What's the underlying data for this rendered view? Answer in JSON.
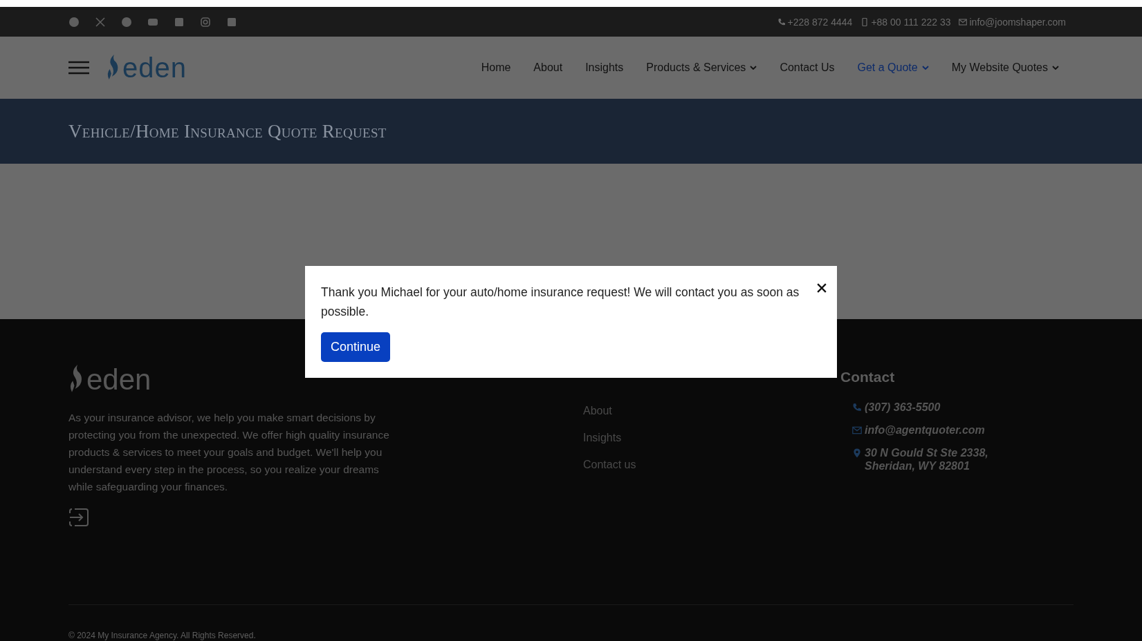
{
  "top_bar": {
    "contacts": [
      {
        "kind": "phone",
        "text": "+228 872 4444"
      },
      {
        "kind": "mobile",
        "text": "+88 00 111 222 33"
      },
      {
        "kind": "email",
        "text": "info@joomshaper.com"
      }
    ]
  },
  "header": {
    "logo": "eden",
    "nav": [
      {
        "label": "Home",
        "selected": false,
        "dropdown": false
      },
      {
        "label": "About",
        "selected": false,
        "dropdown": false
      },
      {
        "label": "Insights",
        "selected": false,
        "dropdown": false
      },
      {
        "label": "Products & Services",
        "selected": false,
        "dropdown": true
      },
      {
        "label": "Contact Us",
        "selected": false,
        "dropdown": false
      },
      {
        "label": "Get a Quote",
        "selected": true,
        "dropdown": true
      },
      {
        "label": "My Website Quotes",
        "selected": false,
        "dropdown": true
      }
    ]
  },
  "page_title": "Vehicle/Home Insurance Quote Request",
  "modal": {
    "message": "Thank you Michael for your auto/home insurance request! We will contact you as soon as possible.",
    "button": "Continue"
  },
  "footer": {
    "logo": "eden",
    "about": "As your insurance advisor, we help you make smart decisions by protecting you from the unexpected. We offer high quality insurance products & services to meet your goals and budget. We'll help you understand every step in the process, so you realize your dreams while safeguarding your finances.",
    "company_links": [
      "About",
      "Insights",
      "Contact us"
    ],
    "contact_heading": "Contact",
    "contacts": [
      {
        "kind": "phone",
        "text": "(307) 363-5500"
      },
      {
        "kind": "email",
        "text": "info@agentquoter.com"
      },
      {
        "kind": "location",
        "text": "30 N Gould St Ste 2338, Sheridan, WY 82801"
      }
    ],
    "copyright": "© 2024 My Insurance Agency. All Rights Reserved."
  }
}
